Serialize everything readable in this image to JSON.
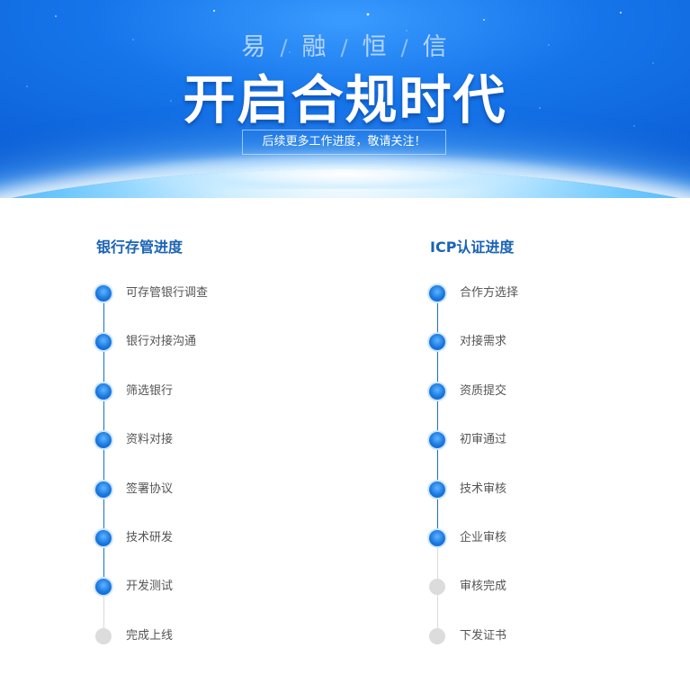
{
  "banner": {
    "brand_chars": [
      "易",
      "融",
      "恒",
      "信"
    ],
    "title": "开启合规时代",
    "notice": "后续更多工作进度，敬请关注！"
  },
  "columns": [
    {
      "title": "银行存管进度",
      "steps": [
        {
          "label": "可存管银行调查",
          "status": "done"
        },
        {
          "label": "银行对接沟通",
          "status": "done"
        },
        {
          "label": "筛选银行",
          "status": "done"
        },
        {
          "label": "资料对接",
          "status": "done"
        },
        {
          "label": "签署协议",
          "status": "done"
        },
        {
          "label": "技术研发",
          "status": "done"
        },
        {
          "label": "开发测试",
          "status": "done"
        },
        {
          "label": "完成上线",
          "status": "pending"
        }
      ]
    },
    {
      "title": "ICP认证进度",
      "steps": [
        {
          "label": "合作方选择",
          "status": "done"
        },
        {
          "label": "对接需求",
          "status": "done"
        },
        {
          "label": "资质提交",
          "status": "done"
        },
        {
          "label": "初审通过",
          "status": "done"
        },
        {
          "label": "技术审核",
          "status": "done"
        },
        {
          "label": "企业审核",
          "status": "done"
        },
        {
          "label": "审核完成",
          "status": "pending"
        },
        {
          "label": "下发证书",
          "status": "pending"
        }
      ]
    }
  ],
  "colors": {
    "accent": "#1a63b6",
    "done_dot": "#1a78e0",
    "pending_dot": "#dcdcdc",
    "track_done": "#1a6fc9",
    "track_pending": "#d9d9d9"
  }
}
